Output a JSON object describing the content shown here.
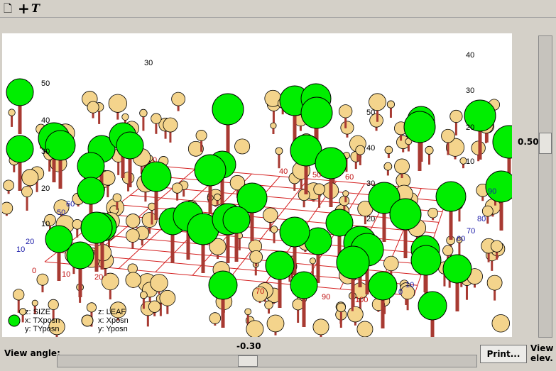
{
  "toolbar": {
    "icons": [
      "new-page-icon",
      "plus-icon",
      "text-tool-icon"
    ],
    "new_glyph": "🗋",
    "plus_glyph": "+",
    "text_glyph": "T"
  },
  "view_angle": {
    "label": "View angle:",
    "value": "-0.30"
  },
  "view_elev": {
    "label": "View elev.",
    "value": "0.50"
  },
  "print_button": "Print...",
  "legend": {
    "left": {
      "z": "z: SIZE",
      "x": "x: TXposn",
      "y": "y: TYposn"
    },
    "right": {
      "z": "z: LEAF",
      "x": "x: Xposn",
      "y": "y: Yposn"
    }
  },
  "colors": {
    "tree_green": "#00ee00",
    "tree_tan": "#f4d48c",
    "trunk": "#a83a32",
    "grid": "#d42020",
    "axis_blue": "#1a1aa8",
    "axis_red": "#c01010"
  },
  "axis_labels": {
    "black_z": [
      "30",
      "50",
      "40",
      "30",
      "20",
      "10",
      "40",
      "30",
      "20",
      "10",
      "50",
      "40",
      "30",
      "20"
    ],
    "red_x": [
      "0",
      "40",
      "50",
      "60",
      "10",
      "20",
      "70",
      "90",
      "100",
      "0"
    ],
    "blue_y": [
      "60",
      "50",
      "20",
      "10",
      "90",
      "80",
      "70",
      "60",
      "10",
      "0"
    ]
  }
}
